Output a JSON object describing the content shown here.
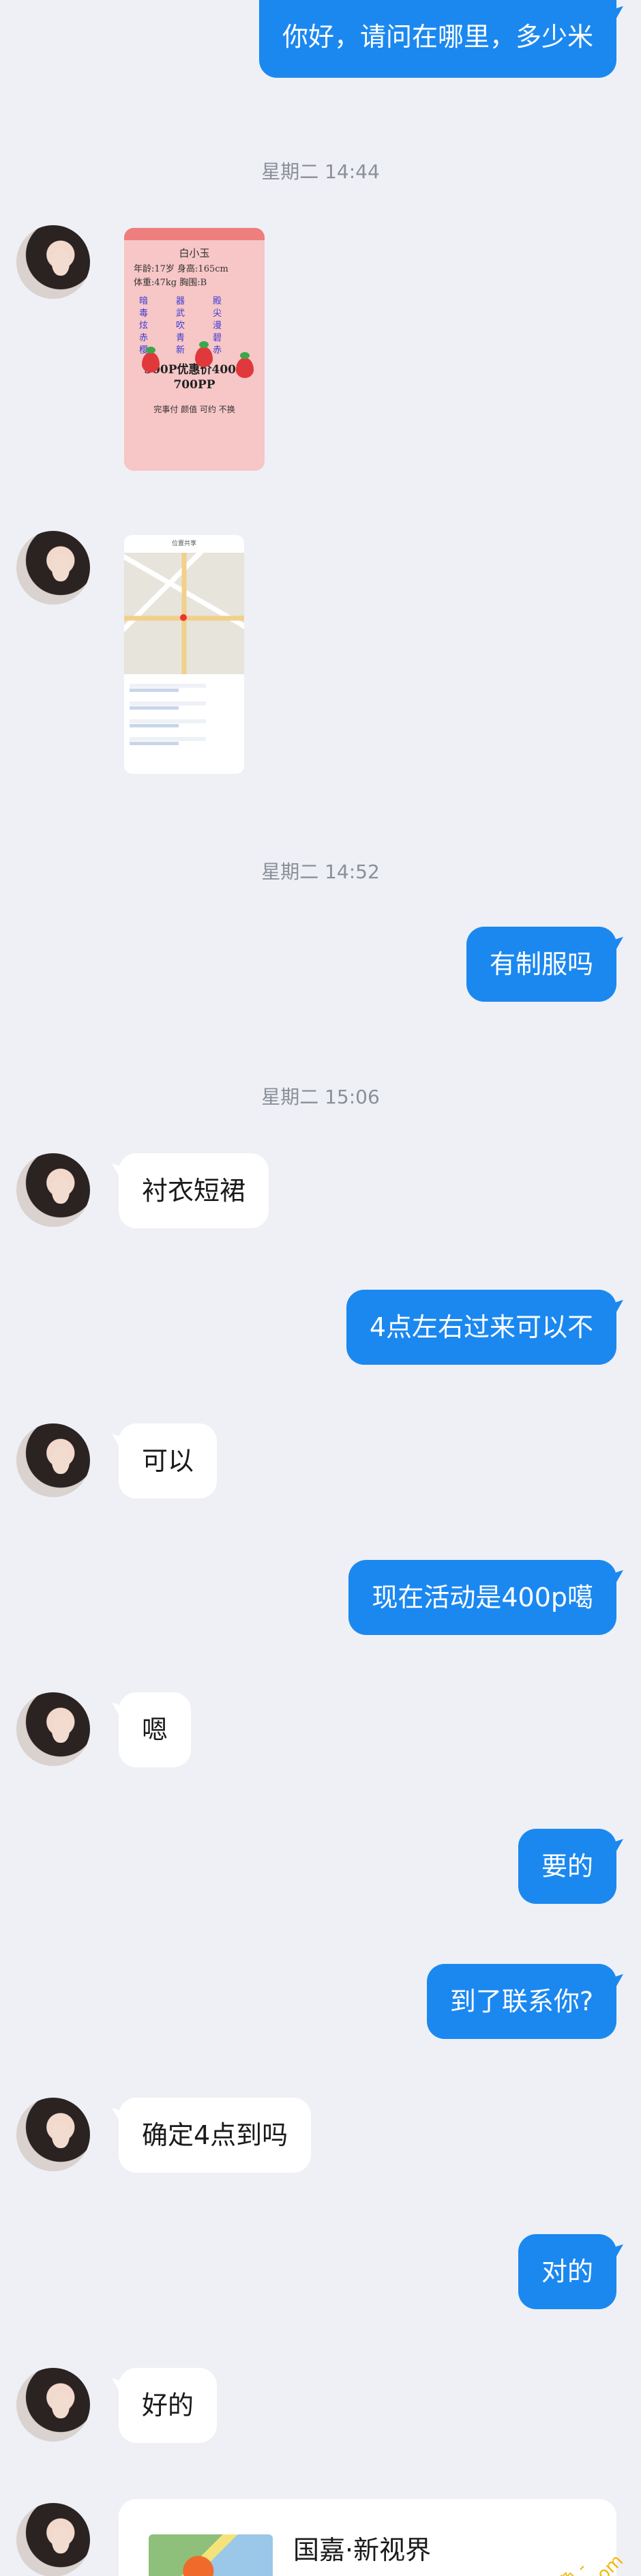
{
  "messages": {
    "m1_out": "你好，请问在哪里，多少米",
    "ts1": "星期二 14:44",
    "ts2": "星期二 14:52",
    "m2_out": "有制服吗",
    "ts3": "星期二 15:06",
    "m3_in": "衬衣短裙",
    "m4_out": "4点左右过来可以不",
    "m5_in": "可以",
    "m6_out": "现在活动是400p噶",
    "m7_in": "嗯",
    "m8_out": "要的",
    "m9_out": "到了联系你?",
    "m10_in": "确定4点到吗",
    "m11_out": "对的",
    "m12_in": "好的"
  },
  "image_card": {
    "name": "白小玉",
    "line1": "年龄:17岁  身高:165cm",
    "line2": "体重:47kg  胸围:B",
    "grid": [
      "暗",
      "器",
      "殿",
      "毒",
      "武",
      "尖",
      "炫",
      "吹",
      "漫",
      "赤",
      "青",
      "碧",
      "樱",
      "新",
      "赤"
    ],
    "price1": "500P优惠价400P",
    "price2": "700PP",
    "foot": "完事付 颜值 可约 不换"
  },
  "map_card": {
    "title": "位置共享"
  },
  "location_card": {
    "title": "国嘉·新视界"
  },
  "watermark": {
    "line1": "- 免费色色 -",
    "line2": "www.MFsese.com"
  },
  "colors": {
    "outgoing_bubble": "#1b88f0",
    "incoming_bubble": "#ffffff",
    "background": "#eef0f5"
  }
}
